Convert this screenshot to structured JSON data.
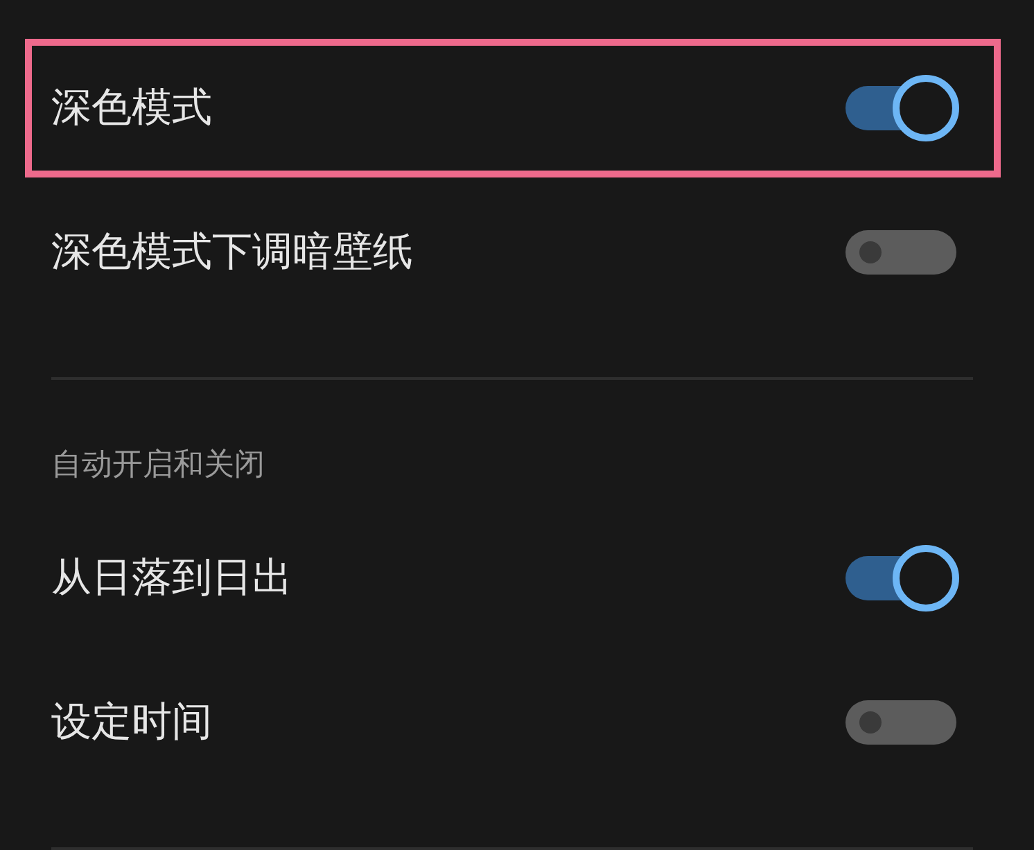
{
  "items": [
    {
      "kind": "toggle",
      "label": "深色模式",
      "on": true,
      "highlighted": true
    },
    {
      "kind": "toggle",
      "label": "深色模式下调暗壁纸",
      "on": false,
      "highlighted": false
    },
    {
      "kind": "divider"
    },
    {
      "kind": "header",
      "label": "自动开启和关闭"
    },
    {
      "kind": "toggle",
      "label": "从日落到日出",
      "on": true,
      "highlighted": false
    },
    {
      "kind": "toggle",
      "label": "设定时间",
      "on": false,
      "highlighted": false
    },
    {
      "kind": "divider"
    }
  ]
}
